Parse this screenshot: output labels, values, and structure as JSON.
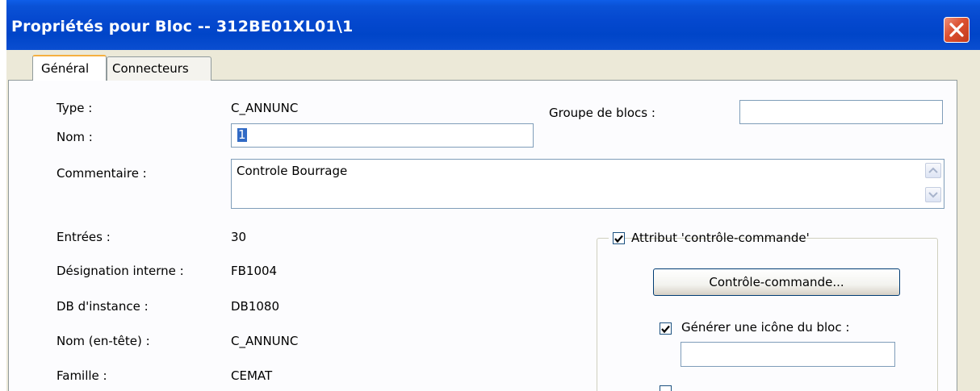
{
  "window": {
    "title": "Propriétés pour Bloc -- 312BE01XL01\\1",
    "accent_color": "#0548cf",
    "close_color": "#db5030"
  },
  "tabs": [
    {
      "label": "Général",
      "selected": true
    },
    {
      "label": "Connecteurs",
      "selected": false
    }
  ],
  "general": {
    "type_label": "Type :",
    "type_value": "C_ANNUNC",
    "name_label": "Nom :",
    "name_value": "1",
    "group_label": "Groupe de blocs :",
    "group_value": "",
    "comment_label": "Commentaire :",
    "comment_value": "Controle Bourrage",
    "inputs_label": "Entrées :",
    "inputs_value": "30",
    "internal_label": "Désignation interne :",
    "internal_value": "FB1004",
    "db_label": "DB d'instance :",
    "db_value": "DB1080",
    "header_name_label": "Nom (en-tête) :",
    "header_name_value": "C_ANNUNC",
    "family_label": "Famille :",
    "family_value": "CEMAT"
  },
  "control_command": {
    "attribute_label": "Attribut 'contrôle-commande'",
    "attribute_checked": true,
    "button_label": "Contrôle-commande...",
    "icon_label": "Générer une icône du bloc :",
    "icon_checked": true,
    "icon_value": ""
  }
}
